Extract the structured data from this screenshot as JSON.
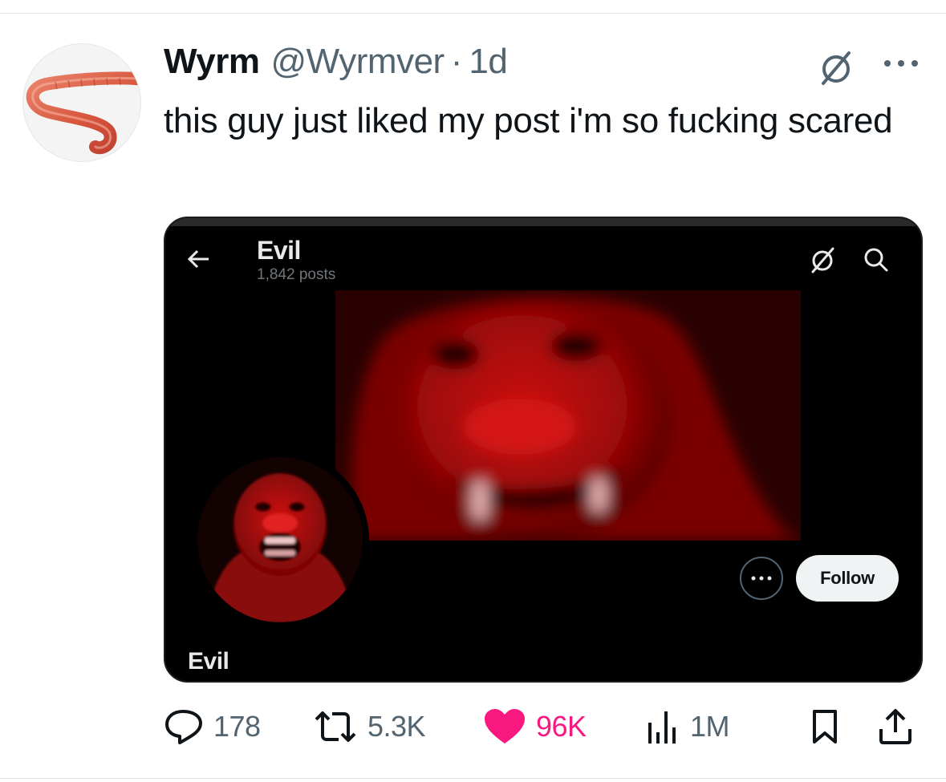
{
  "tweet": {
    "author_name": "Wyrm",
    "handle": "@Wyrmver",
    "separator": "·",
    "time": "1d",
    "text": "this guy just liked my post i'm so fucking scared",
    "avatar_icon": "earthworm-avatar",
    "menu_icon": "more-horizontal-icon",
    "grok_icon": "grok-icon"
  },
  "embedded_screenshot": {
    "profile_title": "Evil",
    "post_count": "1,842 posts",
    "display_name": "Evil",
    "follow_label": "Follow",
    "back_icon": "back-arrow-icon",
    "search_icon": "search-icon",
    "banner_description_icon": "red-monkey-banner",
    "avatar_icon": "red-monkey-avatar",
    "colors": {
      "background": "#000000",
      "accent_red": "#c10a0a",
      "follow_bg": "#eff3f4"
    }
  },
  "actions": {
    "replies": "178",
    "reposts": "5.3K",
    "likes": "96K",
    "views": "1M",
    "like_color": "#f91880",
    "muted_color": "#536471"
  }
}
